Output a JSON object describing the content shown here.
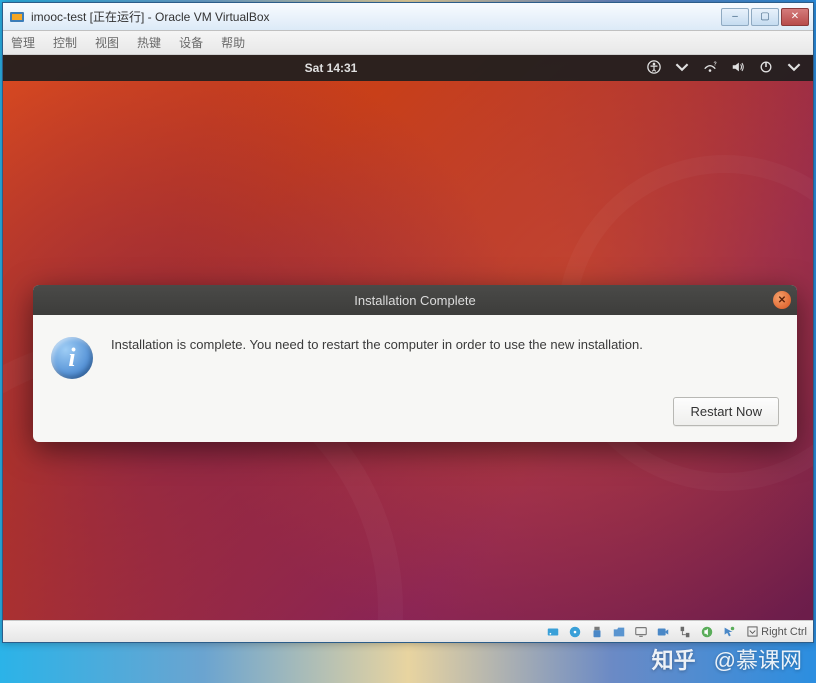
{
  "window": {
    "title": "imooc-test [正在运行] - Oracle VM VirtualBox",
    "minimize": "–",
    "maximize": "▢",
    "close": "✕"
  },
  "menubar": {
    "items": [
      "管理",
      "控制",
      "视图",
      "热键",
      "设备",
      "帮助"
    ]
  },
  "ubuntu": {
    "clock": "Sat 14:31"
  },
  "dialog": {
    "title": "Installation Complete",
    "message": "Installation is complete. You need to restart the computer in order to use the new installation.",
    "button": "Restart Now",
    "close": "✕",
    "info_glyph": "i"
  },
  "statusbar": {
    "host_key": "Right Ctrl"
  },
  "watermark": {
    "zhihu": "知乎",
    "imooc": "@慕课网"
  }
}
